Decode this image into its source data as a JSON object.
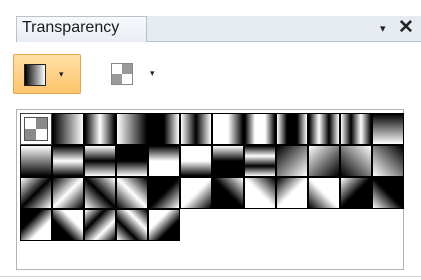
{
  "panel": {
    "tab_label": "Transparency",
    "dropdown_glyph": "▾",
    "close_glyph": "✕"
  },
  "toolbar": {
    "gradient_button": {
      "icon": "gradient-swatch-icon",
      "caret": "▾",
      "active": true
    },
    "pattern_button": {
      "icon": "checker-swatch-icon",
      "caret": "▾",
      "active": false
    }
  },
  "gallery": {
    "columns": 12,
    "selected_index": 0,
    "swatches": [
      {
        "kind": "none"
      },
      {
        "kind": "linear",
        "angle": 90,
        "stops": [
          "#000",
          "#fff"
        ]
      },
      {
        "kind": "linear",
        "angle": 90,
        "stops": [
          "#000",
          "#fff",
          "#000"
        ]
      },
      {
        "kind": "linear",
        "angle": 90,
        "stops": [
          "#fff",
          "#000"
        ]
      },
      {
        "kind": "linear",
        "angle": 90,
        "stops": [
          "#000",
          "#000",
          "#fff"
        ]
      },
      {
        "kind": "linear",
        "angle": 90,
        "stops": [
          "#fff",
          "#000",
          "#fff"
        ]
      },
      {
        "kind": "linear",
        "angle": 90,
        "stops": [
          "#fff",
          "#fff",
          "#000"
        ]
      },
      {
        "kind": "linear",
        "angle": 90,
        "stops": [
          "#000",
          "#fff",
          "#fff",
          "#000"
        ]
      },
      {
        "kind": "linear",
        "angle": 90,
        "stops": [
          "#fff",
          "#000",
          "#000",
          "#fff"
        ]
      },
      {
        "kind": "linear",
        "angle": 90,
        "stops": [
          "#000",
          "#fff",
          "#000",
          "#fff"
        ]
      },
      {
        "kind": "linear",
        "angle": 90,
        "stops": [
          "#fff",
          "#000",
          "#fff",
          "#000"
        ]
      },
      {
        "kind": "linear",
        "angle": 180,
        "stops": [
          "#000",
          "#fff"
        ]
      },
      {
        "kind": "linear",
        "angle": 180,
        "stops": [
          "#fff",
          "#000"
        ]
      },
      {
        "kind": "linear",
        "angle": 180,
        "stops": [
          "#000",
          "#fff",
          "#000"
        ]
      },
      {
        "kind": "linear",
        "angle": 180,
        "stops": [
          "#fff",
          "#000",
          "#fff"
        ]
      },
      {
        "kind": "linear",
        "angle": 180,
        "stops": [
          "#000",
          "#000",
          "#fff"
        ]
      },
      {
        "kind": "linear",
        "angle": 180,
        "stops": [
          "#000",
          "#fff",
          "#fff"
        ]
      },
      {
        "kind": "linear",
        "angle": 180,
        "stops": [
          "#fff",
          "#fff",
          "#000"
        ]
      },
      {
        "kind": "linear",
        "angle": 180,
        "stops": [
          "#fff",
          "#000",
          "#000"
        ]
      },
      {
        "kind": "linear",
        "angle": 180,
        "stops": [
          "#000",
          "#fff",
          "#000",
          "#fff"
        ]
      },
      {
        "kind": "linear",
        "angle": 135,
        "stops": [
          "#000",
          "#fff"
        ]
      },
      {
        "kind": "linear",
        "angle": 135,
        "stops": [
          "#fff",
          "#000"
        ]
      },
      {
        "kind": "linear",
        "angle": 45,
        "stops": [
          "#000",
          "#fff"
        ]
      },
      {
        "kind": "linear",
        "angle": 45,
        "stops": [
          "#fff",
          "#000"
        ]
      },
      {
        "kind": "linear",
        "angle": 135,
        "stops": [
          "#fff",
          "#000",
          "#fff"
        ]
      },
      {
        "kind": "linear",
        "angle": 135,
        "stops": [
          "#000",
          "#fff",
          "#000"
        ]
      },
      {
        "kind": "linear",
        "angle": 45,
        "stops": [
          "#fff",
          "#000",
          "#fff"
        ]
      },
      {
        "kind": "linear",
        "angle": 45,
        "stops": [
          "#000",
          "#fff",
          "#000"
        ]
      },
      {
        "kind": "linear",
        "angle": 135,
        "stops": [
          "#000",
          "#000",
          "#fff"
        ]
      },
      {
        "kind": "linear",
        "angle": 135,
        "stops": [
          "#fff",
          "#fff",
          "#000"
        ]
      },
      {
        "kind": "linear",
        "angle": 45,
        "stops": [
          "#000",
          "#000",
          "#fff"
        ]
      },
      {
        "kind": "linear",
        "angle": 45,
        "stops": [
          "#fff",
          "#fff",
          "#000"
        ]
      },
      {
        "kind": "linear",
        "angle": 135,
        "stops": [
          "#000",
          "#fff",
          "#fff"
        ]
      },
      {
        "kind": "linear",
        "angle": 45,
        "stops": [
          "#000",
          "#fff",
          "#fff"
        ]
      },
      {
        "kind": "linear",
        "angle": 135,
        "stops": [
          "#fff",
          "#000",
          "#000"
        ]
      },
      {
        "kind": "linear",
        "angle": 45,
        "stops": [
          "#fff",
          "#000",
          "#000"
        ]
      },
      {
        "kind": "linear",
        "angle": 135,
        "stops": [
          "#000",
          "#000",
          "#fff",
          "#fff"
        ]
      },
      {
        "kind": "linear",
        "angle": 45,
        "stops": [
          "#000",
          "#000",
          "#fff",
          "#fff"
        ]
      },
      {
        "kind": "linear",
        "angle": 135,
        "stops": [
          "#fff",
          "#000",
          "#fff",
          "#000"
        ]
      },
      {
        "kind": "linear",
        "angle": 45,
        "stops": [
          "#fff",
          "#000",
          "#fff",
          "#000"
        ]
      },
      {
        "kind": "linear",
        "angle": 135,
        "stops": [
          "#fff",
          "#fff",
          "#000",
          "#000"
        ]
      }
    ]
  }
}
